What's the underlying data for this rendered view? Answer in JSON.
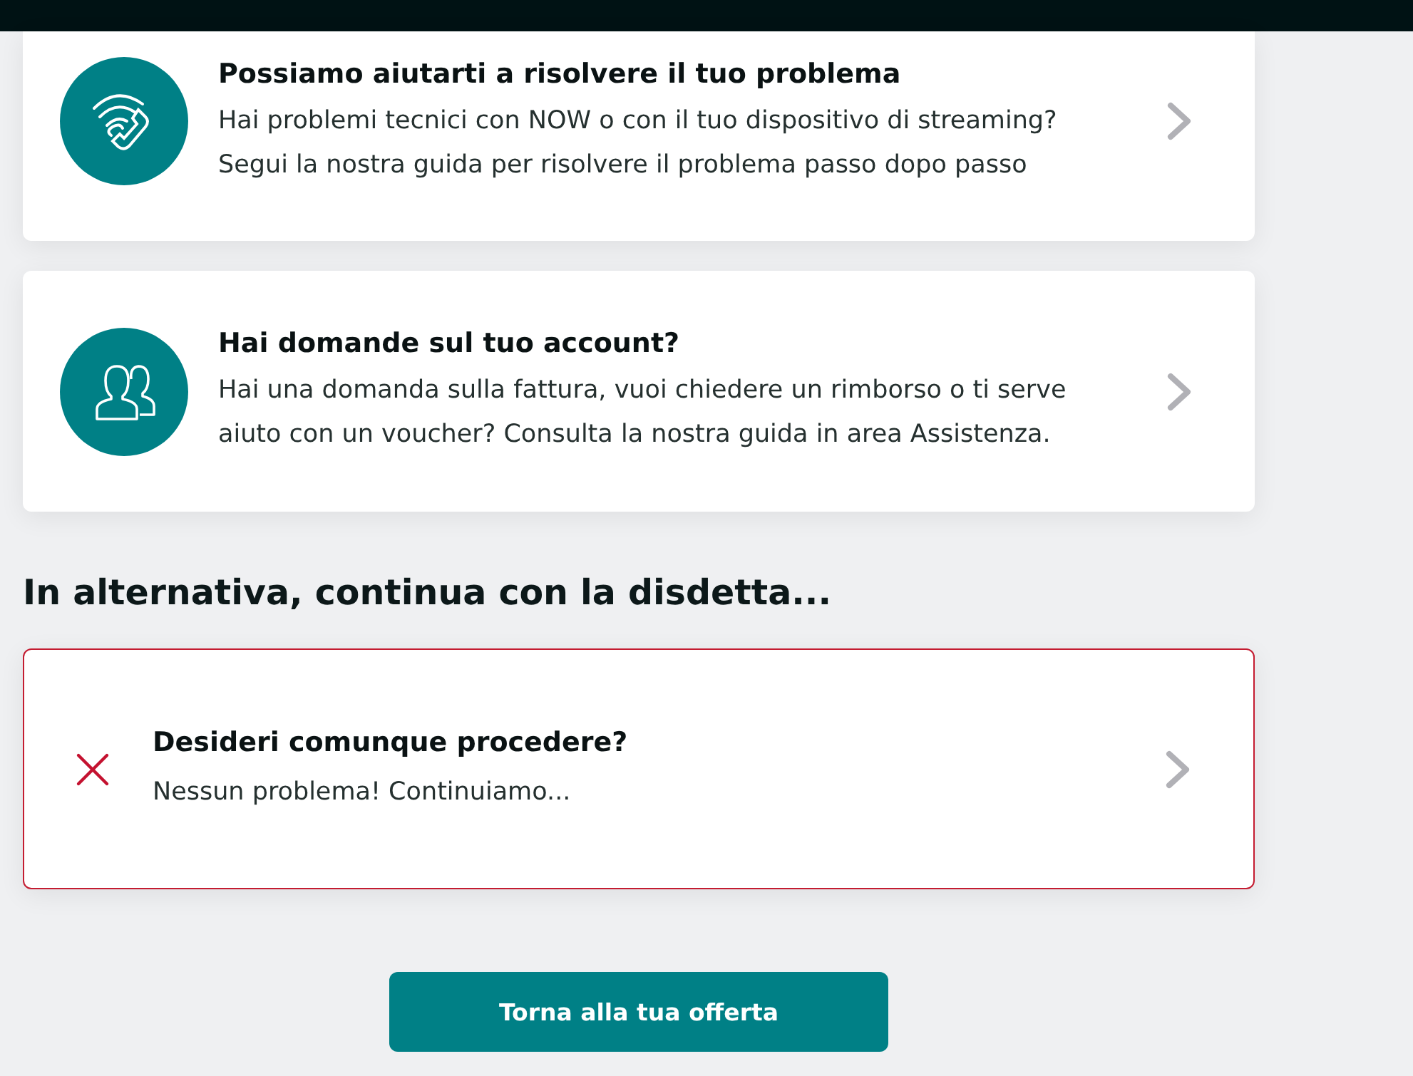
{
  "help_options": [
    {
      "title": "Possiamo aiutarti a risolvere il tuo problema",
      "description": "Hai problemi tecnici con NOW o con il tuo dispositivo di streaming?\nSegui la nostra guida per risolvere il problema passo dopo passo"
    },
    {
      "title": "Hai domande sul tuo account?",
      "description": "Hai una domanda sulla fattura, vuoi chiedere un rimborso o ti serve\naiuto con un voucher? Consulta la nostra guida in area Assistenza."
    }
  ],
  "alternative": {
    "heading": "In alternativa, continua con la disdetta...",
    "option": {
      "title": "Desideri comunque procedere?",
      "description": "Nessun problema! Continuiamo..."
    }
  },
  "back_button": {
    "label": "Torna alla tua offerta"
  }
}
